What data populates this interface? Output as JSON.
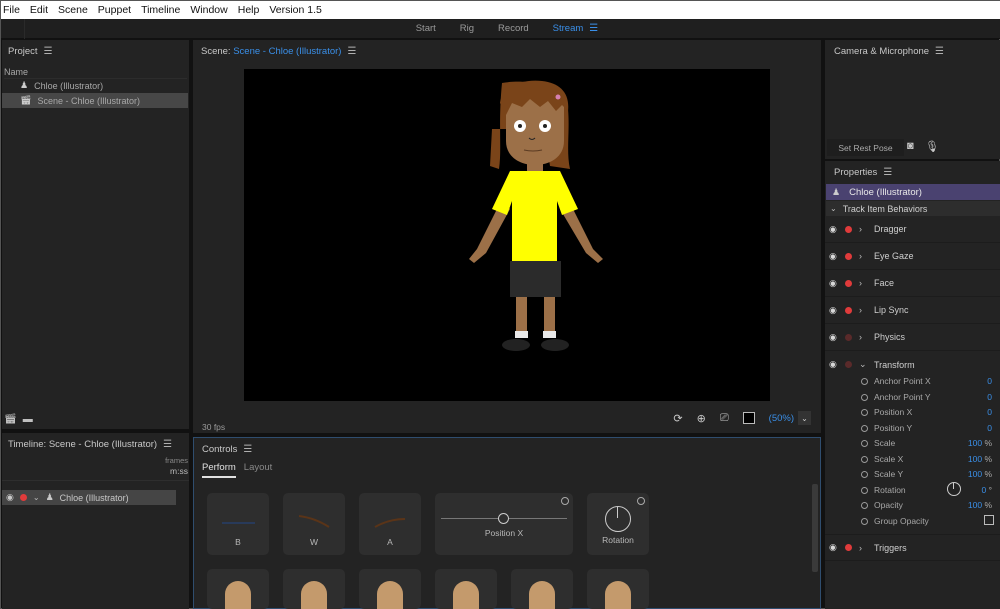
{
  "menu": [
    "File",
    "Edit",
    "Scene",
    "Puppet",
    "Timeline",
    "Window",
    "Help",
    "Version 1.5"
  ],
  "workspace": {
    "tabs": [
      {
        "label": "Start",
        "active": false
      },
      {
        "label": "Rig",
        "active": false
      },
      {
        "label": "Record",
        "active": false
      },
      {
        "label": "Stream",
        "active": true
      }
    ],
    "menu_icon": "hamburger-icon"
  },
  "project": {
    "title": "Project",
    "column_header": "Name",
    "items": [
      {
        "label": "Chloe (Illustrator)",
        "icon": "puppet-icon",
        "selected": false
      },
      {
        "label": "Scene - Chloe (Illustrator)",
        "icon": "scene-icon",
        "selected": true
      }
    ]
  },
  "scene": {
    "title_prefix": "Scene:",
    "title_name": "Scene - Chloe (Illustrator)",
    "fps": "30 fps",
    "zoom": "(50%)",
    "zoom_chevron": "⌄"
  },
  "timeline": {
    "title": "Timeline: Scene - Chloe (Illustrator)",
    "units_top": "frames",
    "units_bottom": "m:ss",
    "track_label": "Chloe (Illustrator)"
  },
  "controls": {
    "title": "Controls",
    "tabs": [
      {
        "label": "Perform",
        "active": true
      },
      {
        "label": "Layout",
        "active": false
      }
    ],
    "tiles": [
      {
        "label": "B"
      },
      {
        "label": "W"
      },
      {
        "label": "A"
      },
      {
        "label": "Position X"
      },
      {
        "label": "Rotation"
      }
    ]
  },
  "camera": {
    "title": "Camera & Microphone",
    "rest_pose": "Set Rest Pose"
  },
  "properties": {
    "title": "Properties",
    "puppet": "Chloe (Illustrator)",
    "section": "Track Item Behaviors",
    "behaviors": [
      {
        "name": "Dragger",
        "armed": true,
        "expanded": false
      },
      {
        "name": "Eye Gaze",
        "armed": true,
        "expanded": false
      },
      {
        "name": "Face",
        "armed": true,
        "expanded": false
      },
      {
        "name": "Lip Sync",
        "armed": true,
        "expanded": false
      },
      {
        "name": "Physics",
        "armed": false,
        "expanded": false
      },
      {
        "name": "Transform",
        "armed": false,
        "expanded": true
      },
      {
        "name": "Triggers",
        "armed": true,
        "expanded": false
      }
    ],
    "transform_params": [
      {
        "name": "Anchor Point X",
        "value": "0",
        "unit": ""
      },
      {
        "name": "Anchor Point Y",
        "value": "0",
        "unit": ""
      },
      {
        "name": "Position X",
        "value": "0",
        "unit": ""
      },
      {
        "name": "Position Y",
        "value": "0",
        "unit": ""
      },
      {
        "name": "Scale",
        "value": "100",
        "unit": " %"
      },
      {
        "name": "Scale X",
        "value": "100",
        "unit": " %"
      },
      {
        "name": "Scale Y",
        "value": "100",
        "unit": " %"
      },
      {
        "name": "Rotation",
        "value": "0",
        "unit": " °"
      },
      {
        "name": "Opacity",
        "value": "100",
        "unit": " %"
      },
      {
        "name": "Group Opacity",
        "value": "",
        "unit": ""
      }
    ]
  },
  "colors": {
    "accent_blue": "#3a8fe8",
    "record_red": "#e03b3b",
    "selected_puppet": "#4a4270",
    "shirt_yellow": "#ffff00"
  }
}
